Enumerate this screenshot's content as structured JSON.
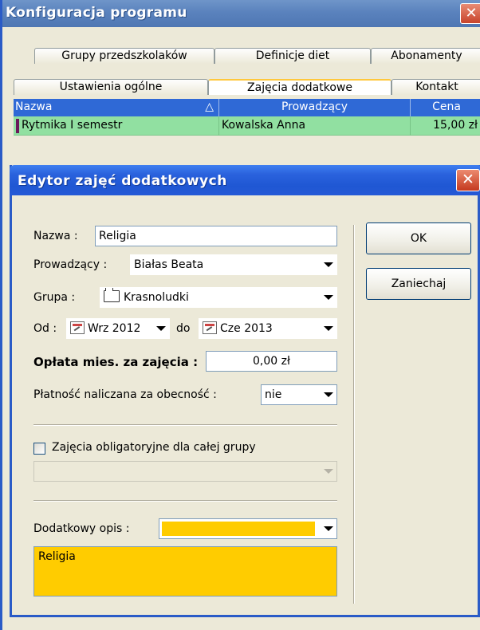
{
  "background_window": {
    "title": "Konfiguracja programu",
    "close_glyph": "✕",
    "tabs_row1": [
      "Grupy przedszkolaków",
      "Definicje diet",
      "Abonamenty"
    ],
    "tabs_row2": [
      "Ustawienia ogólne",
      "Zajęcia dodatkowe",
      "Kontakt"
    ],
    "active_tab": "Zajęcia dodatkowe",
    "grid": {
      "columns": [
        "Nazwa",
        "Prowadzący",
        "Cena"
      ],
      "sort_glyph": "△",
      "rows": [
        {
          "nazwa": "Rytmika I semestr",
          "prowadzacy": "Kowalska Anna",
          "cena": "15,00 zł"
        }
      ]
    }
  },
  "dialog": {
    "title": "Edytor zajęć dodatkowych",
    "close_glyph": "✕",
    "nazwa_label": "Nazwa :",
    "nazwa_value": "Religia",
    "prowadzacy_label": "Prowadzący :",
    "prowadzacy_value": "Białas Beata",
    "grupa_label": "Grupa :",
    "grupa_value": "Krasnoludki",
    "od_label": "Od :",
    "od_value": "Wrz 2012",
    "do_label": "do",
    "do_value": "Cze 2013",
    "oplata_label": "Opłata mies. za zajęcia :",
    "oplata_value": "0,00 zł",
    "platnosc_label": "Płatność naliczana za obecność :",
    "platnosc_value": "nie",
    "obligatoryjne_label": "Zajęcia obligatoryjne dla  całej grupy",
    "obligatoryjne_checked": false,
    "opis_label": "Dodatkowy opis :",
    "opis_color": "#ffcc00",
    "opis_text": "Religia",
    "ok_label": "OK",
    "cancel_label": "Zaniechaj"
  },
  "colors": {
    "dialog_title_bar": "#2a62dd",
    "grid_header": "#2f69d6",
    "grid_row": "#91e0a1",
    "description_fill": "#ffcc00"
  }
}
